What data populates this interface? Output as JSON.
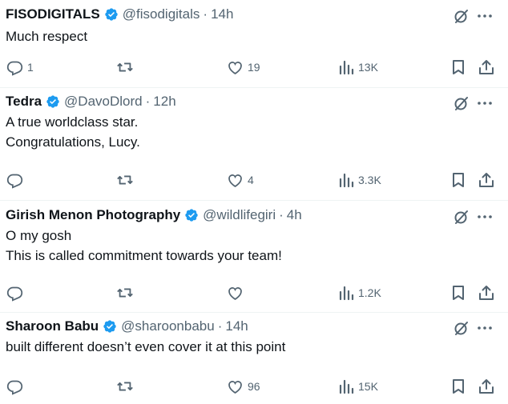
{
  "tweets": [
    {
      "name": "FISODIGITALS",
      "handle": "@fisodigitals",
      "separator": "·",
      "time": "14h",
      "lines": [
        "Much respect"
      ],
      "replies": "1",
      "retweets": "",
      "likes": "19",
      "views": "13K"
    },
    {
      "name": "Tedra",
      "handle": "@DavoDlord",
      "separator": "·",
      "time": "12h",
      "lines": [
        "A true worldclass star.",
        "Congratulations, Lucy."
      ],
      "replies": "",
      "retweets": "",
      "likes": "4",
      "views": "3.3K"
    },
    {
      "name": "Girish Menon Photography",
      "handle": "@wildlifegiri",
      "separator": "·",
      "time": "4h",
      "lines": [
        "O my gosh",
        "This is called commitment towards your team!"
      ],
      "replies": "",
      "retweets": "",
      "likes": "",
      "views": "1.2K"
    },
    {
      "name": "Sharoon Babu",
      "handle": "@sharoonbabu",
      "separator": "·",
      "time": "14h",
      "lines": [
        "built different doesn’t even cover it at this point"
      ],
      "replies": "",
      "retweets": "",
      "likes": "96",
      "views": "15K"
    }
  ],
  "icons": {
    "verified": "verified-badge-icon",
    "grok": "grok-icon",
    "more": "more-icon",
    "reply": "reply-icon",
    "retweet": "retweet-icon",
    "like": "heart-icon",
    "views": "views-icon",
    "bookmark": "bookmark-icon",
    "share": "share-icon"
  },
  "colors": {
    "text": "#0f1419",
    "muted": "#536471",
    "verified": "#1d9bf0",
    "divider": "#eff3f4"
  }
}
